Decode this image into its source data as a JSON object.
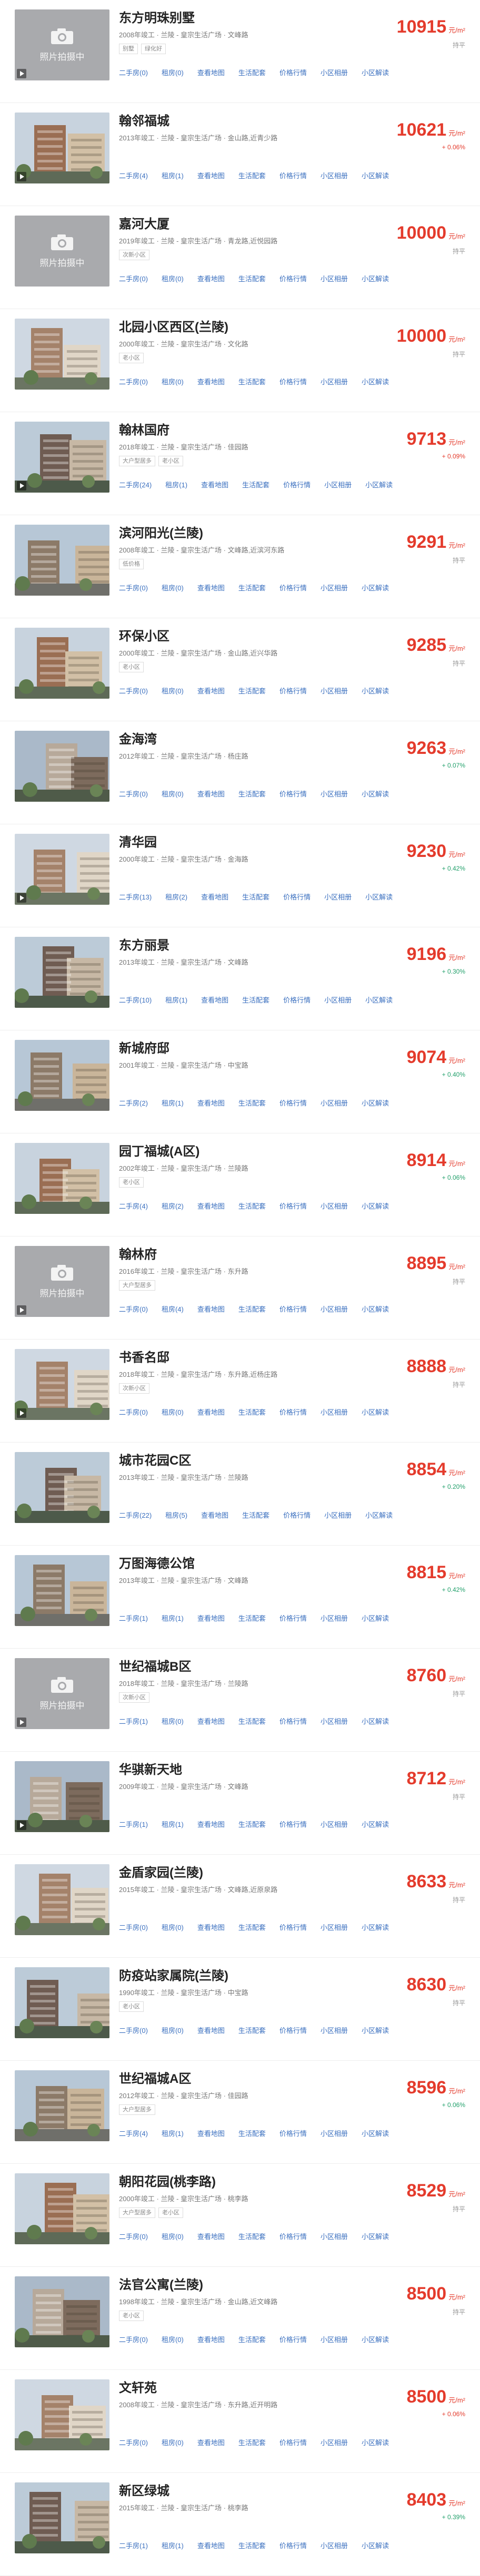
{
  "colors": {
    "price": "#e43b2c",
    "link": "#3a6fbf",
    "down": "#22a06b",
    "placeholder_bg": "#a9aaad"
  },
  "link_labels": [
    "二手房",
    "租房",
    "查看地图",
    "生活配套",
    "价格行情",
    "小区相册",
    "小区解读"
  ],
  "unit": "元/m²",
  "placeholder_text": "照片拍摄中",
  "communities": [
    {
      "name": "东方明珠别墅",
      "meta": "2008年竣工 · 兰陵 - 皇宗生活广场 · 文峰路",
      "tags": [
        "别墅",
        "绿化好"
      ],
      "price": "10915",
      "change": "持平",
      "dir": "flat",
      "thumb": "placeholder",
      "video": true,
      "counts": [
        "0",
        "0"
      ]
    },
    {
      "name": "翰邻福城",
      "meta": "2013年竣工 · 兰陵 - 皇宗生活广场 · 金山路,近青少路",
      "tags": [],
      "price": "10621",
      "change": "+ 0.06%",
      "dir": "up",
      "thumb": "photo",
      "video": true,
      "counts": [
        "4",
        "1"
      ]
    },
    {
      "name": "嘉河大厦",
      "meta": "2019年竣工 · 兰陵 - 皇宗生活广场 · 青龙路,近悦园路",
      "tags": [
        "次新小区"
      ],
      "price": "10000",
      "change": "持平",
      "dir": "flat",
      "thumb": "placeholder",
      "video": false,
      "counts": [
        "0",
        "0"
      ]
    },
    {
      "name": "北园小区西区(兰陵)",
      "meta": "2000年竣工 · 兰陵 - 皇宗生活广场 · 文化路",
      "tags": [
        "老小区"
      ],
      "price": "10000",
      "change": "持平",
      "dir": "flat",
      "thumb": "photo",
      "video": false,
      "counts": [
        "0",
        "0"
      ]
    },
    {
      "name": "翰林国府",
      "meta": "2018年竣工 · 兰陵 - 皇宗生活广场 · 佳园路",
      "tags": [
        "大户型居多",
        "老小区"
      ],
      "price": "9713",
      "change": "+ 0.09%",
      "dir": "up",
      "thumb": "photo",
      "video": true,
      "counts": [
        "24",
        "1"
      ]
    },
    {
      "name": "滨河阳光(兰陵)",
      "meta": "2008年竣工 · 兰陵 - 皇宗生活广场 · 文峰路,近滨河东路",
      "tags": [
        "低价格"
      ],
      "price": "9291",
      "change": "持平",
      "dir": "flat",
      "thumb": "photo",
      "video": false,
      "counts": [
        "0",
        "0"
      ]
    },
    {
      "name": "环保小区",
      "meta": "2000年竣工 · 兰陵 - 皇宗生活广场 · 金山路,近兴华路",
      "tags": [
        "老小区"
      ],
      "price": "9285",
      "change": "持平",
      "dir": "flat",
      "thumb": "photo",
      "video": false,
      "counts": [
        "0",
        "0"
      ]
    },
    {
      "name": "金海湾",
      "meta": "2012年竣工 · 兰陵 - 皇宗生活广场 · 杨庄路",
      "tags": [],
      "price": "9263",
      "change": "+ 0.07%",
      "dir": "down",
      "thumb": "photo",
      "video": false,
      "counts": [
        "0",
        "0"
      ]
    },
    {
      "name": "清华园",
      "meta": "2000年竣工 · 兰陵 - 皇宗生活广场 · 金海路",
      "tags": [],
      "price": "9230",
      "change": "+ 0.42%",
      "dir": "down",
      "thumb": "photo",
      "video": true,
      "counts": [
        "13",
        "2"
      ]
    },
    {
      "name": "东方丽景",
      "meta": "2013年竣工 · 兰陵 - 皇宗生活广场 · 文峰路",
      "tags": [],
      "price": "9196",
      "change": "+ 0.30%",
      "dir": "down",
      "thumb": "photo",
      "video": false,
      "counts": [
        "10",
        "1"
      ]
    },
    {
      "name": "新城府邸",
      "meta": "2001年竣工 · 兰陵 - 皇宗生活广场 · 中宝路",
      "tags": [],
      "price": "9074",
      "change": "+ 0.40%",
      "dir": "down",
      "thumb": "photo",
      "video": false,
      "counts": [
        "2",
        "1"
      ]
    },
    {
      "name": "园丁福城(A区)",
      "meta": "2002年竣工 · 兰陵 - 皇宗生活广场 · 兰陵路",
      "tags": [
        "老小区"
      ],
      "price": "8914",
      "change": "+ 0.06%",
      "dir": "down",
      "thumb": "photo",
      "video": false,
      "counts": [
        "4",
        "2"
      ]
    },
    {
      "name": "翰林府",
      "meta": "2016年竣工 · 兰陵 - 皇宗生活广场 · 东升路",
      "tags": [
        "大户型居多"
      ],
      "price": "8895",
      "change": "持平",
      "dir": "flat",
      "thumb": "placeholder",
      "video": true,
      "counts": [
        "0",
        "4"
      ]
    },
    {
      "name": "书香名邸",
      "meta": "2018年竣工 · 兰陵 - 皇宗生活广场 · 东升路,近杨庄路",
      "tags": [
        "次新小区"
      ],
      "price": "8888",
      "change": "持平",
      "dir": "flat",
      "thumb": "photo",
      "video": true,
      "counts": [
        "0",
        "0"
      ]
    },
    {
      "name": "城市花园C区",
      "meta": "2013年竣工 · 兰陵 - 皇宗生活广场 · 兰陵路",
      "tags": [],
      "price": "8854",
      "change": "+ 0.20%",
      "dir": "down",
      "thumb": "photo",
      "video": false,
      "counts": [
        "22",
        "5"
      ]
    },
    {
      "name": "万图海德公馆",
      "meta": "2013年竣工 · 兰陵 - 皇宗生活广场 · 文峰路",
      "tags": [],
      "price": "8815",
      "change": "+ 0.42%",
      "dir": "down",
      "thumb": "photo",
      "video": false,
      "counts": [
        "1",
        "1"
      ]
    },
    {
      "name": "世纪福城B区",
      "meta": "2018年竣工 · 兰陵 - 皇宗生活广场 · 兰陵路",
      "tags": [
        "次新小区"
      ],
      "price": "8760",
      "change": "持平",
      "dir": "flat",
      "thumb": "placeholder",
      "video": true,
      "counts": [
        "1",
        "0"
      ]
    },
    {
      "name": "华骐新天地",
      "meta": "2009年竣工 · 兰陵 - 皇宗生活广场 · 文峰路",
      "tags": [],
      "price": "8712",
      "change": "持平",
      "dir": "flat",
      "thumb": "photo",
      "video": true,
      "counts": [
        "1",
        "1"
      ]
    },
    {
      "name": "金盾家园(兰陵)",
      "meta": "2015年竣工 · 兰陵 - 皇宗生活广场 · 文峰路,近原泉路",
      "tags": [],
      "price": "8633",
      "change": "持平",
      "dir": "flat",
      "thumb": "photo",
      "video": false,
      "counts": [
        "0",
        "0"
      ]
    },
    {
      "name": "防疫站家属院(兰陵)",
      "meta": "1990年竣工 · 兰陵 - 皇宗生活广场 · 中宝路",
      "tags": [
        "老小区"
      ],
      "price": "8630",
      "change": "持平",
      "dir": "flat",
      "thumb": "photo",
      "video": false,
      "counts": [
        "0",
        "0"
      ]
    },
    {
      "name": "世纪福城A区",
      "meta": "2012年竣工 · 兰陵 - 皇宗生活广场 · 佳园路",
      "tags": [
        "大户型居多"
      ],
      "price": "8596",
      "change": "+ 0.06%",
      "dir": "down",
      "thumb": "photo",
      "video": false,
      "counts": [
        "4",
        "1"
      ]
    },
    {
      "name": "朝阳花园(桃李路)",
      "meta": "2000年竣工 · 兰陵 - 皇宗生活广场 · 桃李路",
      "tags": [
        "大户型居多",
        "老小区"
      ],
      "price": "8529",
      "change": "持平",
      "dir": "flat",
      "thumb": "photo",
      "video": false,
      "counts": [
        "0",
        "0"
      ]
    },
    {
      "name": "法官公寓(兰陵)",
      "meta": "1998年竣工 · 兰陵 - 皇宗生活广场 · 金山路,近文峰路",
      "tags": [
        "老小区"
      ],
      "price": "8500",
      "change": "持平",
      "dir": "flat",
      "thumb": "photo",
      "video": false,
      "counts": [
        "0",
        "0"
      ]
    },
    {
      "name": "文轩苑",
      "meta": "2008年竣工 · 兰陵 - 皇宗生活广场 · 东升路,近开明路",
      "tags": [],
      "price": "8500",
      "change": "+ 0.06%",
      "dir": "up",
      "thumb": "photo",
      "video": false,
      "counts": [
        "0",
        "0"
      ]
    },
    {
      "name": "新区绿城",
      "meta": "2015年竣工 · 兰陵 - 皇宗生活广场 · 桃李路",
      "tags": [],
      "price": "8403",
      "change": "+ 0.39%",
      "dir": "down",
      "thumb": "photo",
      "video": false,
      "counts": [
        "1",
        "1"
      ]
    }
  ]
}
